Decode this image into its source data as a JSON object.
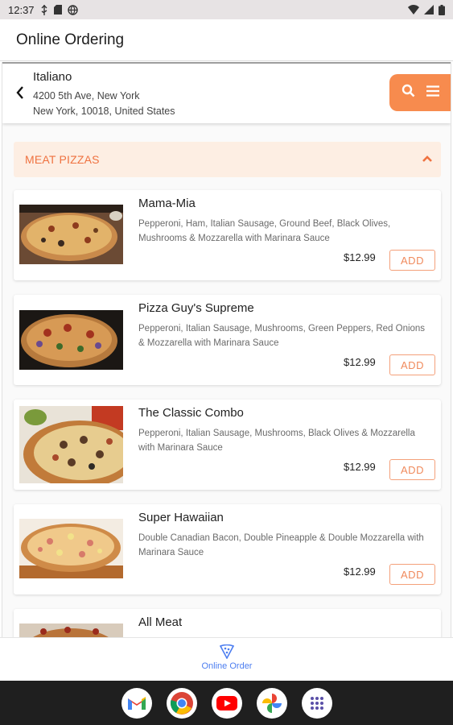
{
  "status_bar": {
    "time": "12:37"
  },
  "app_bar": {
    "title": "Online Ordering"
  },
  "restaurant": {
    "name": "Italiano",
    "address_line1": "4200 5th Ave, New York",
    "address_line2": "New York, 10018, United States"
  },
  "category": {
    "label": "MEAT PIZZAS"
  },
  "menu_items": [
    {
      "name": "Mama-Mia",
      "description": "Pepperoni, Ham, Italian Sausage, Ground Beef, Black Olives, Mushrooms & Mozzarella with Marinara Sauce",
      "price": "$12.99",
      "add_label": "ADD"
    },
    {
      "name": "Pizza Guy's Supreme",
      "description": "Pepperoni, Italian Sausage, Mushrooms, Green Peppers, Red Onions & Mozzarella with Marinara Sauce",
      "price": "$12.99",
      "add_label": "ADD"
    },
    {
      "name": "The Classic Combo",
      "description": "Pepperoni, Italian Sausage, Mushrooms, Black Olives & Mozzarella with Marinara Sauce",
      "price": "$12.99",
      "add_label": "ADD"
    },
    {
      "name": "Super Hawaiian",
      "description": "Double Canadian Bacon, Double Pineapple & Double Mozzarella with Marinara Sauce",
      "price": "$12.99",
      "add_label": "ADD"
    },
    {
      "name": "All Meat",
      "description": "",
      "price": "",
      "add_label": ""
    }
  ],
  "bottom_nav": {
    "online_order_label": "Online Order"
  },
  "dock": {
    "apps": [
      "gmail-icon",
      "chrome-icon",
      "youtube-icon",
      "photos-icon",
      "app-drawer-icon"
    ]
  },
  "colors": {
    "accent": "#f78b4e",
    "category_bg": "#fdeee3",
    "category_text": "#ef7240",
    "nav_active": "#4d7ef0"
  }
}
